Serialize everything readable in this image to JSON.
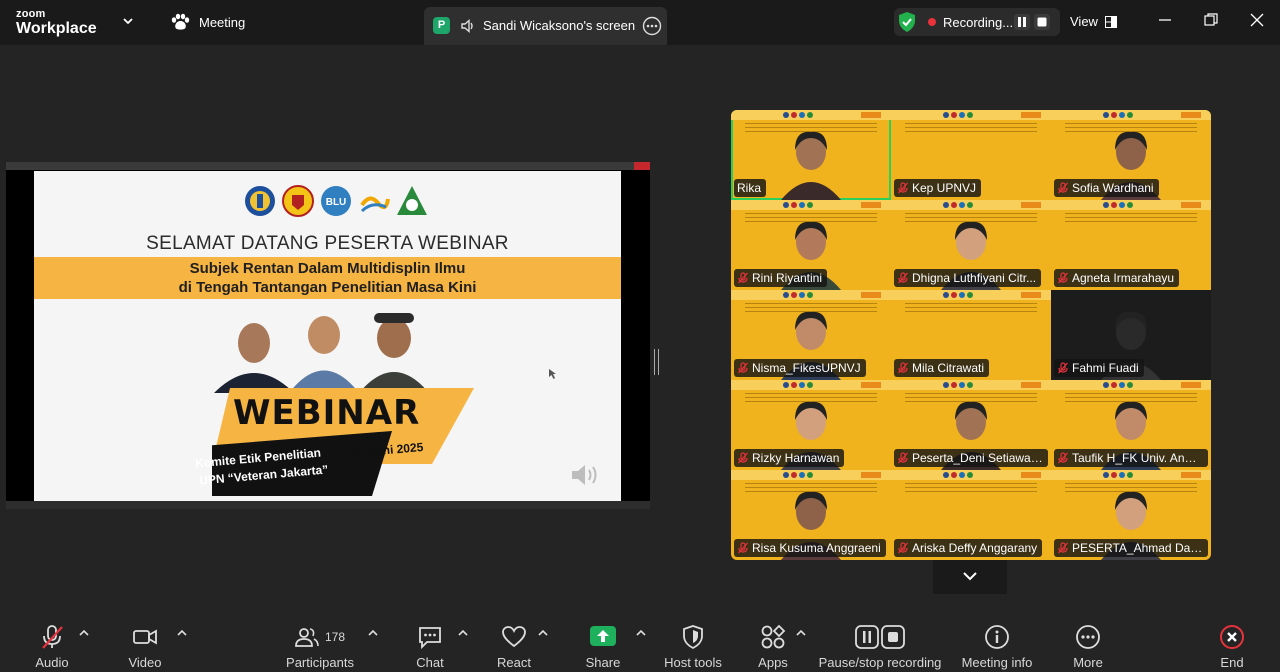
{
  "app": {
    "brand_top": "zoom",
    "brand_bottom": "Workplace"
  },
  "header": {
    "meeting_label": "Meeting",
    "share_badge": "P",
    "share_label": "Sandi Wicaksono's screen",
    "recording_label": "Recording...",
    "view_label": "View"
  },
  "slide": {
    "title": "SELAMAT DATANG PESERTA WEBINAR",
    "subtitle_line1": "Subjek Rentan Dalam Multidisplin Ilmu",
    "subtitle_line2": "di Tengah Tantangan Penelitian Masa Kini",
    "banner_word": "WEBINAR",
    "org_line1": "Komite Etik Penelitian",
    "org_line2": "UPN “Veteran Jakarta”",
    "date": "26 Juni 2025",
    "logo_blu": "BLU"
  },
  "participants_tiles": [
    {
      "name": "Rika",
      "muted": false,
      "active": true,
      "video": "person"
    },
    {
      "name": "Kep UPNVJ",
      "muted": true,
      "video": "slide"
    },
    {
      "name": "Sofia Wardhani",
      "muted": true,
      "video": "person"
    },
    {
      "name": "Rini Riyantini",
      "muted": true,
      "video": "person"
    },
    {
      "name": "Dhigna Luthfiyani Citr...",
      "muted": true,
      "video": "person"
    },
    {
      "name": "Agneta Irmarahayu",
      "muted": true,
      "video": "slide"
    },
    {
      "name": "Nisma_FikesUPNVJ",
      "muted": true,
      "video": "person"
    },
    {
      "name": "Mila Citrawati",
      "muted": true,
      "video": "slide"
    },
    {
      "name": "Fahmi Fuadi",
      "muted": true,
      "video": "dark"
    },
    {
      "name": "Rizky Harnawan",
      "muted": true,
      "video": "person"
    },
    {
      "name": "Peserta_Deni Setiawati...",
      "muted": true,
      "video": "person"
    },
    {
      "name": "Taufik H_FK Univ. Anda...",
      "muted": true,
      "video": "person"
    },
    {
      "name": "Risa Kusuma Anggraeni",
      "muted": true,
      "video": "person"
    },
    {
      "name": "Ariska Deffy Anggarany",
      "muted": true,
      "video": "slide"
    },
    {
      "name": "PESERTA_Ahmad Daffa...",
      "muted": true,
      "video": "person"
    }
  ],
  "toolbar": {
    "audio": "Audio",
    "video": "Video",
    "participants": "Participants",
    "participants_count": "178",
    "chat": "Chat",
    "react": "React",
    "share": "Share",
    "host_tools": "Host tools",
    "apps": "Apps",
    "pause_stop": "Pause/stop recording",
    "meeting_info": "Meeting info",
    "more": "More",
    "end": "End"
  },
  "colors": {
    "accent_green": "#2bd05b",
    "share_green": "#1fb05e",
    "record_red": "#e8323c",
    "tile_yellow": "#f0b21d",
    "end_red": "#e8323c"
  }
}
